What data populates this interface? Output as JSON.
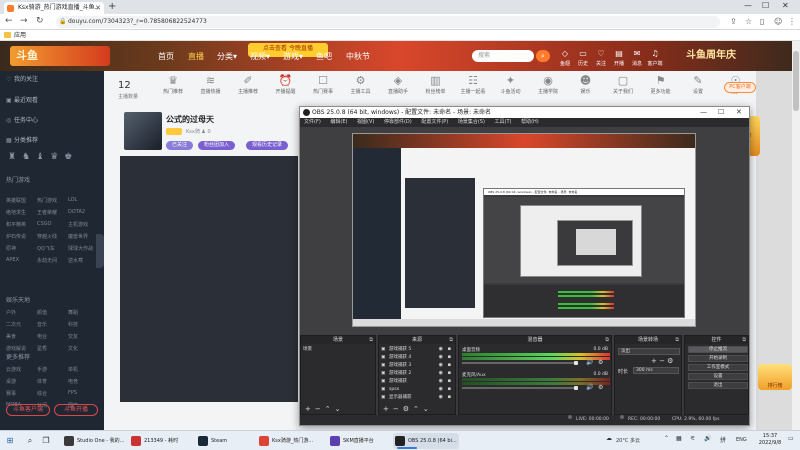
{
  "browser": {
    "tab_title": "Ksx骑游_热门游戏直播_斗鱼...",
    "url": "douyu.com/7304323?_r=0.785806822524773",
    "bookmark": "应用",
    "new_tab": "+",
    "win_min": "—",
    "win_max": "☐",
    "win_close": "✕"
  },
  "douyu": {
    "logo": "斗鱼",
    "nav": [
      {
        "label": "首页"
      },
      {
        "label": "直播"
      },
      {
        "label": "分类▾"
      },
      {
        "label": "视频▾"
      },
      {
        "label": "游戏▾"
      },
      {
        "label": "鱼吧"
      },
      {
        "label": "中秋节"
      }
    ],
    "cc_badge": "点击查看 今晚直播",
    "search_placeholder": "搜索",
    "header_icons": [
      {
        "icon": "◇",
        "label": "鱼翅"
      },
      {
        "icon": "▭",
        "label": "历史"
      },
      {
        "icon": "♡",
        "label": "关注"
      },
      {
        "icon": "▤",
        "label": "开播"
      },
      {
        "icon": "✉",
        "label": "消息"
      },
      {
        "icon": "♫",
        "label": "客户端"
      },
      {
        "icon": "☺",
        "label": "我的"
      }
    ],
    "banner_right": "斗鱼周年庆",
    "sidebar": {
      "items": [
        {
          "icon": "♡",
          "label": "我的关注"
        },
        {
          "icon": "▣",
          "label": "最近观看"
        },
        {
          "icon": "◎",
          "label": "任务中心"
        },
        {
          "icon": "▦",
          "label": "分类推荐"
        }
      ],
      "section_games": "热门游戏",
      "section_lab": "娱乐天地",
      "section_more": "更多推荐",
      "grid_games": [
        "英雄联盟",
        "热门游戏",
        "LOL",
        "绝地求生",
        "王者荣耀",
        "DOTA2",
        "和平精英",
        "CSGO",
        "主机游戏",
        "炉石传说",
        "穿越火线",
        "魔兽世界",
        "原神",
        "QQ飞车",
        "球球大作战",
        "APEX",
        "永劫无间",
        "逆水寒"
      ],
      "grid_fun": [
        "户外",
        "颜值",
        "舞蹈",
        "二次元",
        "音乐",
        "科技",
        "美食",
        "电台",
        "交友",
        "游戏解说",
        "星秀",
        "文化"
      ],
      "grid_more": [
        "云游戏",
        "手游",
        "单机",
        "桌游",
        "体育",
        "电竞",
        "赛事",
        "综合",
        "FPS",
        "MOBA",
        "休闲",
        "国产"
      ],
      "bottom_left": "斗鱼客户端",
      "bottom_right": "斗鱼开播"
    },
    "count": "12",
    "count_label": "主播数量",
    "categories": [
      {
        "icon": "♛",
        "label": "热门推荐"
      },
      {
        "icon": "≋",
        "label": "直播热播"
      },
      {
        "icon": "✐",
        "label": "主播推荐"
      },
      {
        "icon": "⏰",
        "label": "开播提醒"
      },
      {
        "icon": "☐",
        "label": "热门赛事"
      },
      {
        "icon": "⚙",
        "label": "主播工具"
      },
      {
        "icon": "◈",
        "label": "直播助手"
      },
      {
        "icon": "▥",
        "label": "粉丝榜单"
      },
      {
        "icon": "☷",
        "label": "主播一起看"
      },
      {
        "icon": "✦",
        "label": "斗鱼活动"
      },
      {
        "icon": "◉",
        "label": "主播学院"
      },
      {
        "icon": "☻",
        "label": "娱乐"
      },
      {
        "icon": "▢",
        "label": "关于我们"
      },
      {
        "icon": "⚑",
        "label": "更多功能"
      },
      {
        "icon": "✎",
        "label": "设置"
      },
      {
        "icon": "☉",
        "label": "更多"
      }
    ],
    "pc_button": "PC客户端",
    "room": {
      "title": "公式的过母天",
      "meta": "Ksx骑 ♟ 0",
      "pills": [
        {
          "label": "已关注",
          "color": "#8a7bd8"
        },
        {
          "label": "粉丝团加入",
          "color": "#7a5fd0"
        },
        {
          "label": "观看历史记录",
          "color": "#7a5fd0"
        }
      ]
    }
  },
  "obs": {
    "title": "OBS 25.0.8 (64 bit, windows) - 配置文件: 未命名 - 场景: 未命名",
    "menu": [
      "文件(F)",
      "编辑(E)",
      "视图(V)",
      "停靠部件(D)",
      "配置文件(P)",
      "场景集合(S)",
      "工具(T)",
      "帮助(H)"
    ],
    "docks": {
      "scenes": {
        "title": "场景",
        "items": [
          "场景"
        ]
      },
      "sources": {
        "title": "来源",
        "items": [
          "游戏捕获 5",
          "游戏捕获 4",
          "游戏捕获 3",
          "游戏捕获 2",
          "游戏捕获",
          "spsx",
          "显示器捕获"
        ]
      },
      "mixer": {
        "title": "混音器",
        "channels": [
          {
            "name": "桌面音频",
            "db": "0.0 dB"
          },
          {
            "name": "麦克风/Aux",
            "db": "0.0 dB"
          }
        ]
      },
      "transitions": {
        "title": "场景转场",
        "fade": "淡出",
        "duration_label": "时长",
        "duration_value": "300 ms"
      },
      "controls": {
        "title": "控件",
        "buttons": [
          "停止推流",
          "开始录制",
          "工作室模式",
          "设置",
          "退出"
        ]
      }
    },
    "status": {
      "live": "LIVE: 00:00:00",
      "rec": "REC: 00:00:00",
      "cpu": "CPU: 2.9%, 60.00 fps"
    },
    "nested_title": "OBS 25.0.8 (64 bit, windows) - 配置文件: 未命名 - 场景: 未命名"
  },
  "taskbar": {
    "apps": [
      {
        "label": "Studio One - 我的...",
        "color": "#3a3a3a"
      },
      {
        "label": "213349 - 耗时",
        "color": "#cc3333"
      },
      {
        "label": "Steam",
        "color": "#1b2838"
      },
      {
        "label": "Ksx骑游_热门游...",
        "color": "#db4437"
      },
      {
        "label": "SKM直播平台",
        "color": "#5a3fb0"
      },
      {
        "label": "OBS 25.0.8 (64 bi...",
        "color": "#222222"
      }
    ],
    "weather": "20°C 多云",
    "lang": "ENG",
    "time": "15:37",
    "date": "2022/9/8"
  }
}
